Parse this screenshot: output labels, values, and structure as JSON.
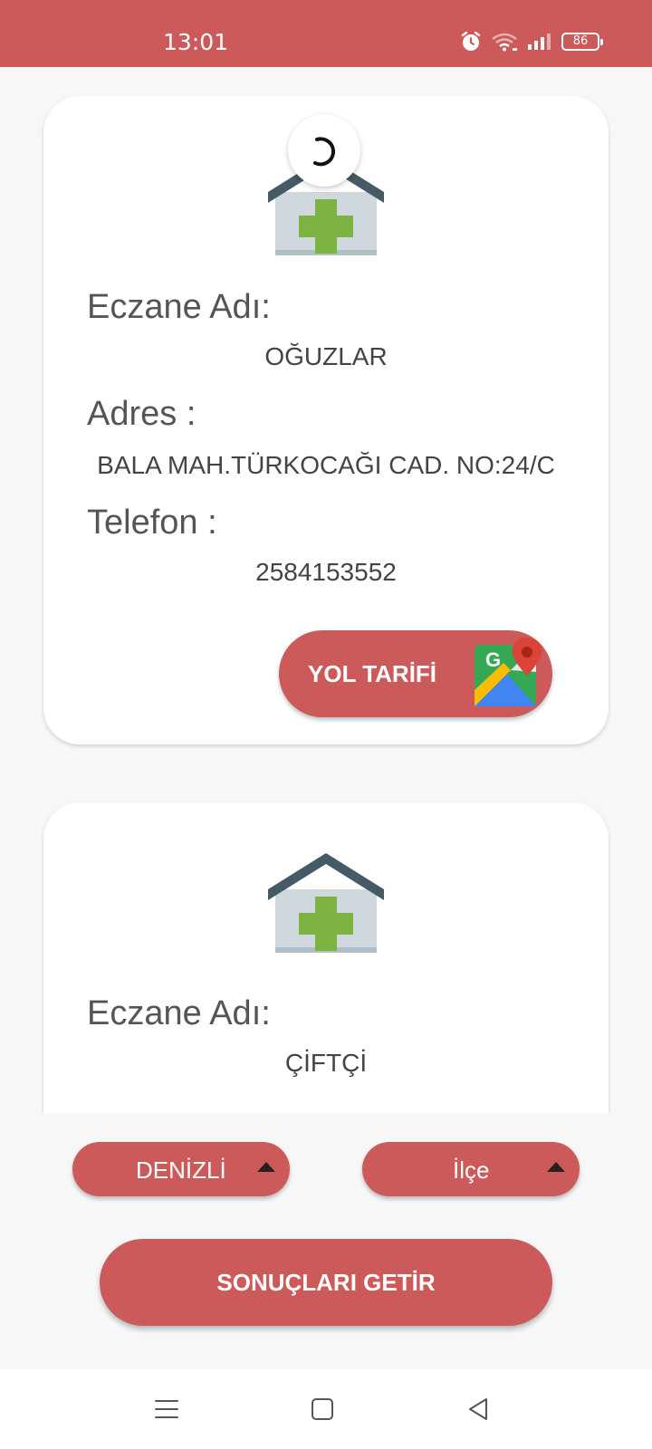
{
  "status_bar": {
    "time": "13:01",
    "battery": "86",
    "icons": [
      "alarm-icon",
      "wifi-icon",
      "signal-icon",
      "battery-icon"
    ]
  },
  "colors": {
    "accent": "#cc5a5a",
    "background": "#f7f7f7",
    "card": "#ffffff"
  },
  "pharmacies": [
    {
      "name_label": "Eczane Adı:",
      "name": "OĞUZLAR",
      "address_label": "Adres :",
      "address": "BALA MAH.TÜRKOCAĞI CAD. NO:24/C",
      "phone_label": "Telefon :",
      "phone": "2584153552",
      "directions_label": "YOL TARİFİ"
    },
    {
      "name_label": "Eczane Adı:",
      "name": "ÇİFTÇİ"
    }
  ],
  "filters": {
    "city_value": "DENİZLİ",
    "district_value": "İlçe"
  },
  "submit_label": "SONUÇLARI GETİR",
  "nav": [
    "menu-icon",
    "home-icon",
    "back-icon"
  ]
}
